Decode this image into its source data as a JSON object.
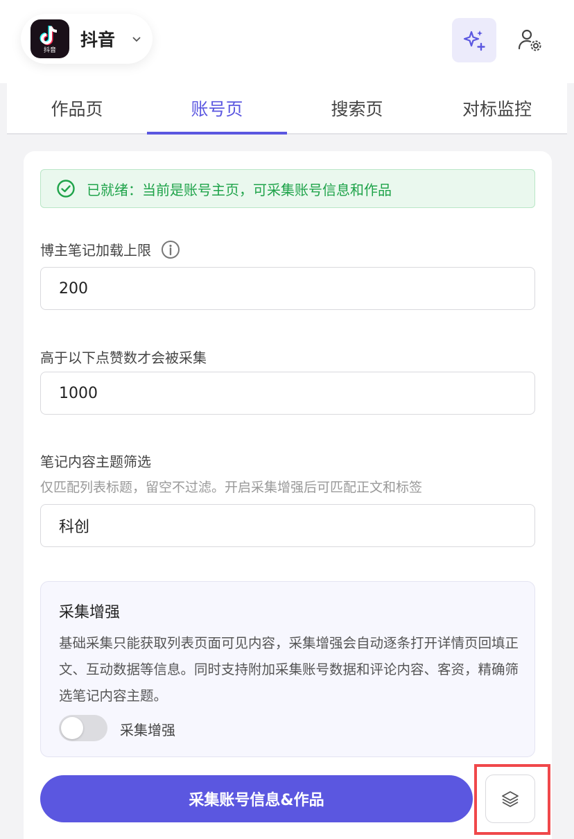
{
  "header": {
    "app_name": "抖音",
    "logo_caption": "抖音"
  },
  "tabs": [
    {
      "label": "作品页",
      "active": false
    },
    {
      "label": "账号页",
      "active": true
    },
    {
      "label": "搜索页",
      "active": false
    },
    {
      "label": "对标监控",
      "active": false
    }
  ],
  "status": {
    "text": "已就绪：当前是账号主页，可采集账号信息和作品"
  },
  "fields": {
    "note_limit": {
      "label": "博主笔记加载上限",
      "value": "200"
    },
    "likes_threshold": {
      "label": "高于以下点赞数才会被采集",
      "value": "1000"
    },
    "topic_filter": {
      "label": "笔记内容主题筛选",
      "hint": "仅匹配列表标题，留空不过滤。开启采集增强后可匹配正文和标签",
      "value": "科创"
    }
  },
  "enhance": {
    "title": "采集增强",
    "description": "基础采集只能获取列表页面可见内容，采集增强会自动逐条打开详情页回填正文、互动数据等信息。同时支持附加采集账号数据和评论内容、客资，精确筛选笔记内容主题。",
    "toggle_label": "采集增强",
    "enabled": false
  },
  "actions": {
    "primary_label": "采集账号信息&作品"
  },
  "colors": {
    "accent": "#5b57e0",
    "success": "#1fa34a",
    "highlight": "#f0484b"
  },
  "icons": {
    "ai": "sparkles-icon",
    "user_settings": "user-gear-icon",
    "status": "check-circle-icon",
    "info": "info-icon",
    "layers": "layers-icon"
  }
}
